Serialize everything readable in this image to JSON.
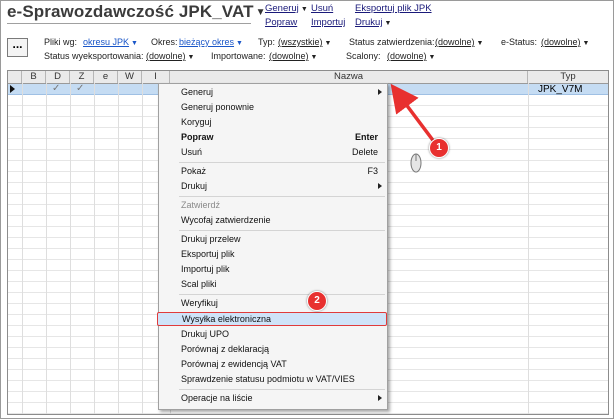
{
  "header": {
    "title": "e-Sprawozdawczość JPK_VAT",
    "links": {
      "generuj": "Generuj",
      "usun": "Usuń",
      "eksportuj_plik_jpk": "Eksportuj plik JPK",
      "popraw": "Popraw",
      "importuj": "Importuj",
      "drukuj": "Drukuj"
    }
  },
  "toolbar": {
    "more_button": "..."
  },
  "filters": {
    "pliki_wg_label": "Pliki wg:",
    "pliki_wg_value": "okresu JPK",
    "okres_label": "Okres:",
    "okres_value": "bieżący okres",
    "typ_label": "Typ:",
    "typ_value": "(wszystkie)",
    "status_zatw_label": "Status zatwierdzenia:",
    "status_zatw_value": "(dowolne)",
    "estatus_label": "e-Status:",
    "estatus_value": "(dowolne)",
    "status_wyeksp_label": "Status wyeksportowania:",
    "status_wyeksp_value": "(dowolne)",
    "importowane_label": "Importowane:",
    "importowane_value": "(dowolne)",
    "scalony_label": "Scalony:",
    "scalony_value": "(dowolne)"
  },
  "table": {
    "columns": [
      "B",
      "D",
      "Z",
      "e",
      "W",
      "I",
      "Nazwa",
      "Typ"
    ],
    "rows": [
      {
        "B": "",
        "D": "✓",
        "Z": "✓",
        "e": "",
        "W": "",
        "I": "",
        "Nazwa": "",
        "Typ": "JPK_V7M"
      }
    ]
  },
  "context_menu": {
    "items": [
      {
        "label": "Generuj",
        "shortcut": "",
        "submenu": true
      },
      {
        "label": "Generuj ponownie",
        "shortcut": ""
      },
      {
        "label": "Koryguj",
        "shortcut": ""
      },
      {
        "label": "Popraw",
        "shortcut": "Enter",
        "bold": true
      },
      {
        "label": "Usuń",
        "shortcut": "Delete"
      },
      {
        "label": "Pokaż",
        "shortcut": "F3"
      },
      {
        "label": "Drukuj",
        "shortcut": "",
        "submenu": true
      },
      {
        "label": "Zatwierdź",
        "shortcut": "",
        "disabled": true
      },
      {
        "label": "Wycofaj zatwierdzenie",
        "shortcut": ""
      },
      {
        "label": "Drukuj przelew",
        "shortcut": ""
      },
      {
        "label": "Eksportuj plik",
        "shortcut": ""
      },
      {
        "label": "Importuj plik",
        "shortcut": ""
      },
      {
        "label": "Scal pliki",
        "shortcut": ""
      },
      {
        "label": "Weryfikuj",
        "shortcut": ""
      },
      {
        "label": "Wysyłka elektroniczna",
        "shortcut": "",
        "highlighted": true
      },
      {
        "label": "Drukuj UPO",
        "shortcut": ""
      },
      {
        "label": "Porównaj z deklaracją",
        "shortcut": ""
      },
      {
        "label": "Porównaj z ewidencją VAT",
        "shortcut": ""
      },
      {
        "label": "Sprawdzenie statusu podmiotu w VAT/VIES",
        "shortcut": ""
      },
      {
        "label": "Operacje na liście",
        "shortcut": "",
        "submenu": true
      }
    ]
  },
  "annotations": {
    "badge1": "1",
    "badge2": "2"
  },
  "colors": {
    "badge": "#e8302f",
    "selection": "#c5dcf3",
    "highlight_border": "#e03b3b",
    "link_blue": "#1a56c8"
  }
}
